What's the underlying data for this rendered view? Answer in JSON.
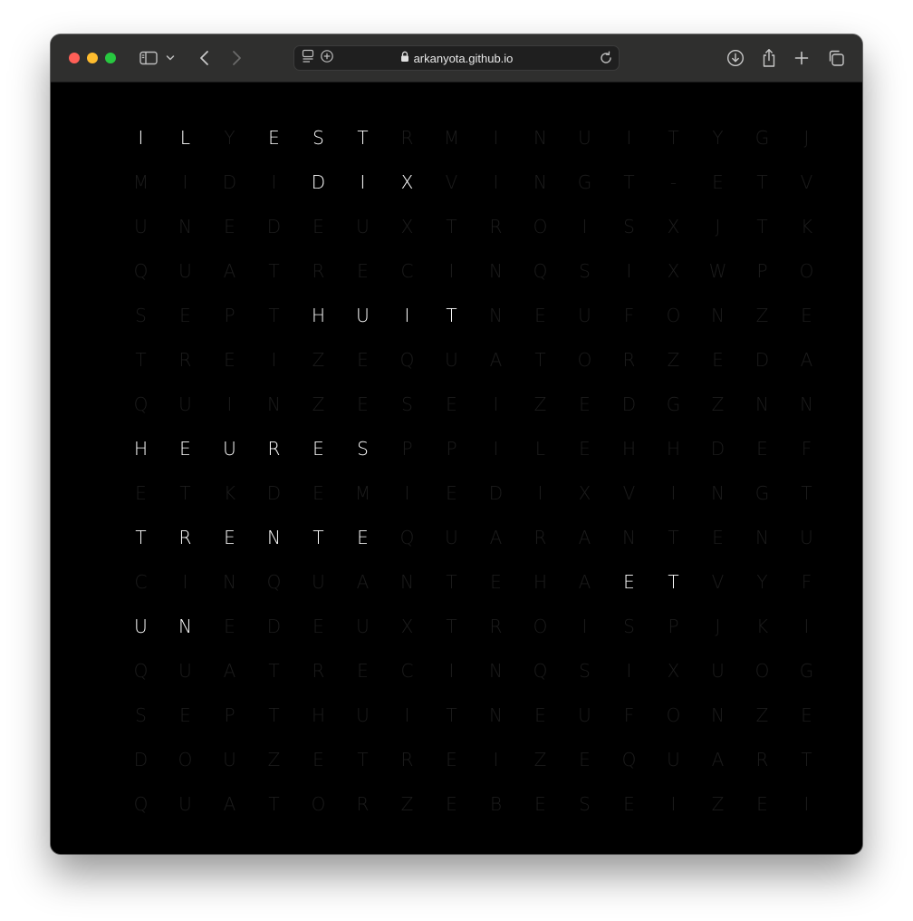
{
  "window": {
    "url": "arkanyota.github.io"
  },
  "icons": {
    "sidebar": "sidebar-icon",
    "sidebar_menu": "chevron-down-icon",
    "back": "back-icon",
    "forward": "forward-icon",
    "reader": "reader-icon",
    "extension": "extension-icon",
    "lock": "lock-icon",
    "reload": "reload-icon",
    "downloads": "download-icon",
    "share": "share-icon",
    "new_tab": "plus-icon",
    "tab_overview": "tabs-icon"
  },
  "colors": {
    "lit": "#ffffff",
    "dim": "#1c1c1c",
    "background": "#000000"
  },
  "clock": {
    "rows": [
      "ILYESTRMINUITYGJ",
      "MIDIDIXVINGT-ETV",
      "UNEDEUXTROISXJTK",
      "QUATRECINQSIXWPO",
      "SEPTHUITNEUFONZE",
      "TREIZEQUATORZEDA",
      "QUINZESEIZEDGZNN",
      "HEURESPPILEHHDEF",
      "ETKDEMIEDIXVINGT",
      "TRENTEQUARANTENU",
      "CINQUANTEHAETVYF",
      "UNEDEUXTROISPJKI",
      "QUATRECINQSIXUOG",
      "SEPTHUITNEUFONZE",
      "DOUZETREIZEQUART",
      "QUATORZEBESEIZEI"
    ],
    "lit": [
      [
        0,
        0
      ],
      [
        0,
        1
      ],
      [
        0,
        3
      ],
      [
        0,
        4
      ],
      [
        0,
        5
      ],
      [
        1,
        4
      ],
      [
        1,
        5
      ],
      [
        1,
        6
      ],
      [
        4,
        4
      ],
      [
        4,
        5
      ],
      [
        4,
        6
      ],
      [
        4,
        7
      ],
      [
        7,
        0
      ],
      [
        7,
        1
      ],
      [
        7,
        2
      ],
      [
        7,
        3
      ],
      [
        7,
        4
      ],
      [
        7,
        5
      ],
      [
        9,
        0
      ],
      [
        9,
        1
      ],
      [
        9,
        2
      ],
      [
        9,
        3
      ],
      [
        9,
        4
      ],
      [
        9,
        5
      ],
      [
        10,
        11
      ],
      [
        10,
        12
      ],
      [
        11,
        0
      ],
      [
        11,
        1
      ]
    ]
  }
}
